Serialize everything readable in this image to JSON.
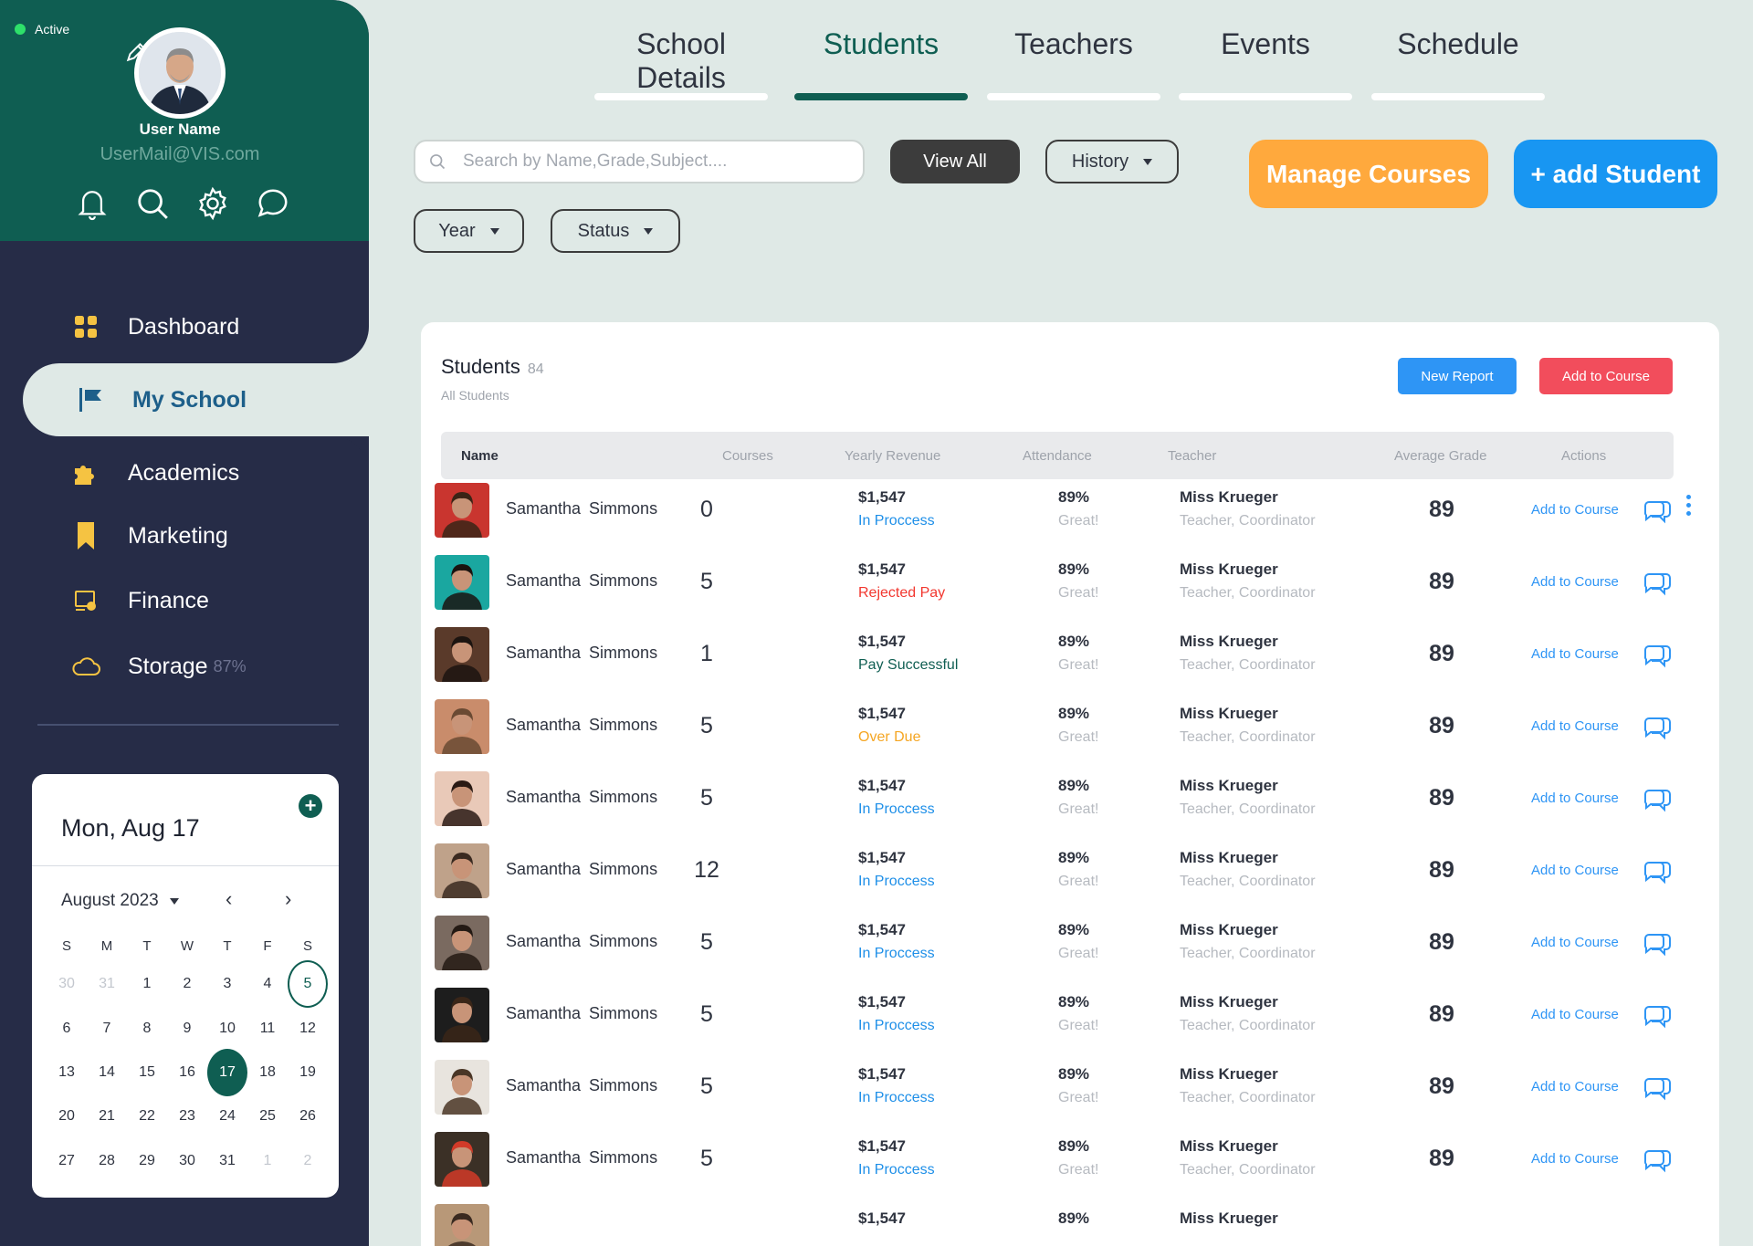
{
  "profile": {
    "status": "Active",
    "user_name": "User Name",
    "user_mail": "UserMail@VIS.com"
  },
  "nav": {
    "items": [
      {
        "label": "Dashboard",
        "icon": "dashboard-grid-icon"
      },
      {
        "label": "My School",
        "icon": "flag-icon",
        "active": true
      },
      {
        "label": "Academics",
        "icon": "puzzle-icon"
      },
      {
        "label": "Marketing",
        "icon": "bookmark-icon"
      },
      {
        "label": "Finance",
        "icon": "finance-board-icon"
      },
      {
        "label": "Storage",
        "icon": "cloud-icon",
        "extra": "87%"
      }
    ]
  },
  "calendar": {
    "date_label": "Mon, Aug 17",
    "month_label": "August 2023",
    "weekdays": [
      "S",
      "M",
      "T",
      "W",
      "T",
      "F",
      "S"
    ],
    "days": [
      {
        "d": "30",
        "m": true
      },
      {
        "d": "31",
        "m": true
      },
      {
        "d": "1"
      },
      {
        "d": "2"
      },
      {
        "d": "3"
      },
      {
        "d": "4"
      },
      {
        "d": "5",
        "ring": true
      },
      {
        "d": "6"
      },
      {
        "d": "7"
      },
      {
        "d": "8"
      },
      {
        "d": "9"
      },
      {
        "d": "10"
      },
      {
        "d": "11"
      },
      {
        "d": "12"
      },
      {
        "d": "13"
      },
      {
        "d": "14"
      },
      {
        "d": "15"
      },
      {
        "d": "16"
      },
      {
        "d": "17",
        "sel": true
      },
      {
        "d": "18"
      },
      {
        "d": "19"
      },
      {
        "d": "20"
      },
      {
        "d": "21"
      },
      {
        "d": "22"
      },
      {
        "d": "23"
      },
      {
        "d": "24"
      },
      {
        "d": "25"
      },
      {
        "d": "26"
      },
      {
        "d": "27"
      },
      {
        "d": "28"
      },
      {
        "d": "29"
      },
      {
        "d": "30"
      },
      {
        "d": "31"
      },
      {
        "d": "1",
        "m": true
      },
      {
        "d": "2",
        "m": true
      }
    ]
  },
  "tabs": [
    {
      "label": "School Details"
    },
    {
      "label": "Students",
      "active": true
    },
    {
      "label": "Teachers"
    },
    {
      "label": "Events"
    },
    {
      "label": "Schedule"
    }
  ],
  "toolbar": {
    "search_placeholder": "Search by Name,Grade,Subject....",
    "view_all": "View All",
    "history": "History",
    "year": "Year",
    "status": "Status",
    "manage_courses": "Manage Courses",
    "add_student": "+ add Student"
  },
  "card": {
    "title": "Students",
    "count": "84",
    "subtitle": "All Students",
    "new_report": "New Report",
    "add_to_course": "Add to Course"
  },
  "table": {
    "columns": [
      "Name",
      "Courses",
      "Yearly Revenue",
      "Attendance",
      "Teacher",
      "Average Grade",
      "Actions"
    ],
    "rows": [
      {
        "name": "Samantha  Simmons",
        "courses": "0",
        "revenue": "$1,547",
        "status": "In Proccess",
        "status_color": "#1e8fe8",
        "attendance": "89%",
        "att_label": "Great!",
        "teacher": "Miss Krueger",
        "role": "Teacher, Coordinator",
        "grade": "89",
        "action": "Add to Course",
        "more": true
      },
      {
        "name": "Samantha  Simmons",
        "courses": "5",
        "revenue": "$1,547",
        "status": "Rejected Pay",
        "status_color": "#f2372f",
        "attendance": "89%",
        "att_label": "Great!",
        "teacher": "Miss Krueger",
        "role": "Teacher, Coordinator",
        "grade": "89",
        "action": "Add to Course"
      },
      {
        "name": "Samantha  Simmons",
        "courses": "1",
        "revenue": "$1,547",
        "status": "Pay Successful",
        "status_color": "#0f5e52",
        "attendance": "89%",
        "att_label": "Great!",
        "teacher": "Miss Krueger",
        "role": "Teacher, Coordinator",
        "grade": "89",
        "action": "Add to Course"
      },
      {
        "name": "Samantha  Simmons",
        "courses": "5",
        "revenue": "$1,547",
        "status": "Over Due",
        "status_color": "#f5a623",
        "attendance": "89%",
        "att_label": "Great!",
        "teacher": "Miss Krueger",
        "role": "Teacher, Coordinator",
        "grade": "89",
        "action": "Add to Course"
      },
      {
        "name": "Samantha  Simmons",
        "courses": "5",
        "revenue": "$1,547",
        "status": "In Proccess",
        "status_color": "#1e8fe8",
        "attendance": "89%",
        "att_label": "Great!",
        "teacher": "Miss Krueger",
        "role": "Teacher, Coordinator",
        "grade": "89",
        "action": "Add to Course"
      },
      {
        "name": "Samantha  Simmons",
        "courses": "12",
        "revenue": "$1,547",
        "status": "In Proccess",
        "status_color": "#1e8fe8",
        "attendance": "89%",
        "att_label": "Great!",
        "teacher": "Miss Krueger",
        "role": "Teacher, Coordinator",
        "grade": "89",
        "action": "Add to Course"
      },
      {
        "name": "Samantha  Simmons",
        "courses": "5",
        "revenue": "$1,547",
        "status": "In Proccess",
        "status_color": "#1e8fe8",
        "attendance": "89%",
        "att_label": "Great!",
        "teacher": "Miss Krueger",
        "role": "Teacher, Coordinator",
        "grade": "89",
        "action": "Add to Course"
      },
      {
        "name": "Samantha  Simmons",
        "courses": "5",
        "revenue": "$1,547",
        "status": "In Proccess",
        "status_color": "#1e8fe8",
        "attendance": "89%",
        "att_label": "Great!",
        "teacher": "Miss Krueger",
        "role": "Teacher, Coordinator",
        "grade": "89",
        "action": "Add to Course"
      },
      {
        "name": "Samantha  Simmons",
        "courses": "5",
        "revenue": "$1,547",
        "status": "In Proccess",
        "status_color": "#1e8fe8",
        "attendance": "89%",
        "att_label": "Great!",
        "teacher": "Miss Krueger",
        "role": "Teacher, Coordinator",
        "grade": "89",
        "action": "Add to Course"
      },
      {
        "name": "Samantha  Simmons",
        "courses": "5",
        "revenue": "$1,547",
        "status": "In Proccess",
        "status_color": "#1e8fe8",
        "attendance": "89%",
        "att_label": "Great!",
        "teacher": "Miss Krueger",
        "role": "Teacher, Coordinator",
        "grade": "89",
        "action": "Add to Course"
      },
      {
        "name": "",
        "courses": "",
        "revenue": "$1,547",
        "status": "",
        "status_color": "#1e8fe8",
        "attendance": "89%",
        "att_label": "",
        "teacher": "Miss Krueger",
        "role": "",
        "grade": "",
        "action": "",
        "partial": true
      }
    ]
  },
  "colors": {
    "brand_green": "#0f5e52",
    "sidebar_navy": "#262c47",
    "page_bg": "#dfe9e6",
    "accent_orange": "#ffa93d",
    "accent_blue": "#1896f2",
    "danger_red": "#f24d5c"
  }
}
